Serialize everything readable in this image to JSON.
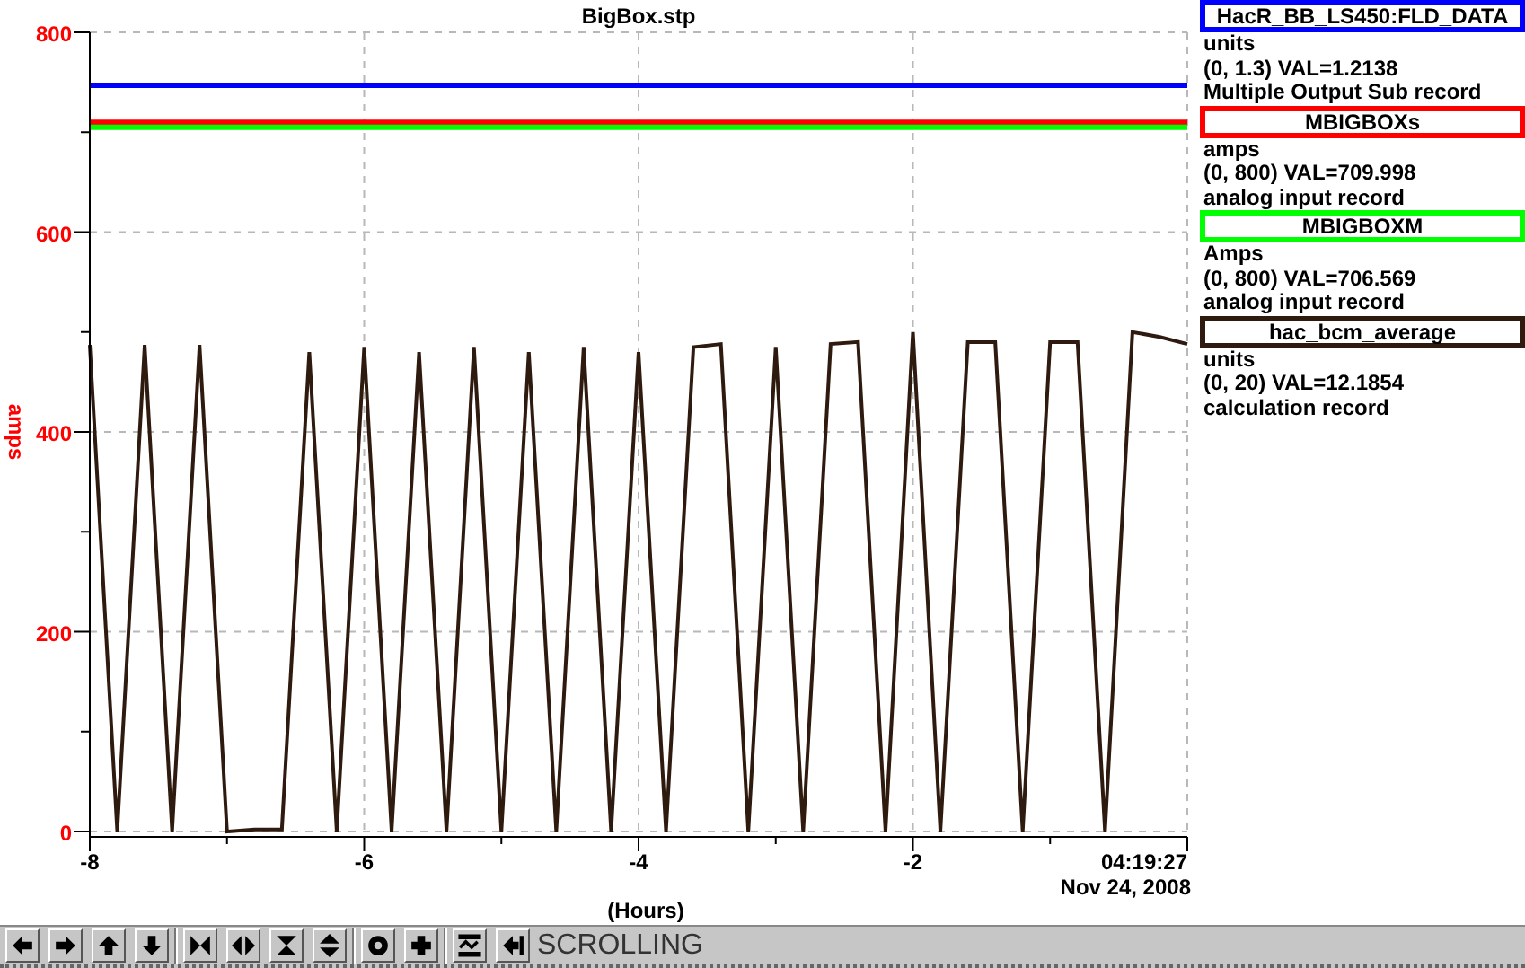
{
  "chart_data": {
    "type": "line",
    "title": "BigBox.stp",
    "xlabel": "(Hours)",
    "ylabel": "amps",
    "x": [
      -8,
      -7.8,
      -7.6,
      -7.4,
      -7.2,
      -7,
      -6.8,
      -6.6,
      -6.4,
      -6.2,
      -6,
      -5.8,
      -5.6,
      -5.4,
      -5.2,
      -5,
      -4.8,
      -4.6,
      -4.4,
      -4.2,
      -4,
      -3.8,
      -3.6,
      -3.4,
      -3.2,
      -3,
      -2.8,
      -2.6,
      -2.4,
      -2.2,
      -2,
      -1.8,
      -1.6,
      -1.4,
      -1.2,
      -1,
      -0.8,
      -0.6,
      -0.4,
      -0.2,
      0
    ],
    "grid": true,
    "xlim": [
      -8,
      0
    ],
    "ylim": [
      0,
      800
    ],
    "xticks": [
      -8,
      -6,
      -4,
      -2
    ],
    "yticks": [
      0,
      200,
      400,
      600,
      800
    ],
    "series": [
      {
        "name": "HacR_BB_LS450:FLD_DATA",
        "color": "#0000ff",
        "values": [
          747,
          747,
          747,
          747,
          747,
          747,
          747,
          747,
          747,
          747,
          747,
          747,
          747,
          747,
          747,
          747,
          747,
          747,
          747,
          747,
          747,
          747,
          747,
          747,
          747,
          747,
          747,
          747,
          747,
          747,
          747,
          747,
          747,
          747,
          747,
          747,
          747,
          747,
          747,
          747,
          747
        ]
      },
      {
        "name": "MBIGBOXs",
        "color": "#ff0000",
        "values": [
          710,
          710,
          710,
          710,
          710,
          710,
          710,
          710,
          710,
          710,
          710,
          710,
          710,
          710,
          710,
          710,
          710,
          710,
          710,
          710,
          710,
          710,
          710,
          710,
          710,
          710,
          710,
          710,
          710,
          710,
          710,
          710,
          710,
          710,
          710,
          710,
          710,
          710,
          710,
          710,
          710
        ]
      },
      {
        "name": "MBIGBOXM",
        "color": "#00ff00",
        "values": [
          705,
          705,
          705,
          705,
          705,
          705,
          705,
          705,
          705,
          705,
          705,
          705,
          705,
          705,
          705,
          705,
          705,
          705,
          705,
          705,
          705,
          705,
          705,
          705,
          705,
          705,
          705,
          705,
          705,
          705,
          705,
          705,
          705,
          705,
          705,
          705,
          705,
          705,
          705,
          705,
          705
        ]
      },
      {
        "name": "hac_bcm_average",
        "color": "#2e1a0e",
        "values": [
          487,
          0,
          487,
          0,
          487,
          0,
          2,
          2,
          480,
          0,
          485,
          0,
          480,
          0,
          485,
          0,
          480,
          0,
          485,
          0,
          480,
          0,
          485,
          488,
          0,
          485,
          0,
          488,
          490,
          0,
          500,
          0,
          490,
          490,
          0,
          490,
          490,
          0,
          500,
          495,
          488
        ]
      }
    ]
  },
  "time_label": "04:19:27",
  "date_label": "Nov 24, 2008",
  "legend": [
    {
      "units": "units",
      "reading": "(0, 1.3) VAL=1.2138",
      "record": "Multiple Output Sub record"
    },
    {
      "units": "amps",
      "reading": "(0, 800) VAL=709.998",
      "record": "analog input record"
    },
    {
      "units": "Amps",
      "reading": "(0, 800) VAL=706.569",
      "record": "analog input record"
    },
    {
      "units": "units",
      "reading": "(0, 20) VAL=12.1854",
      "record": "calculation record"
    }
  ],
  "toolbar": {
    "status": "SCROLLING"
  }
}
